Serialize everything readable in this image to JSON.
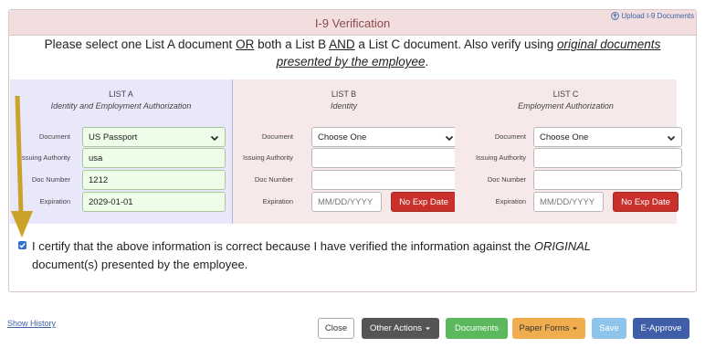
{
  "panel": {
    "title": "I-9 Verification",
    "upload_link": "Upload I-9 Documents"
  },
  "instructions": {
    "part1": "Please select one List A document ",
    "or": "OR",
    "part2": " both a List B ",
    "and": "AND",
    "part3": " a List C document. Also verify using ",
    "emph": "original documents presented by the employee",
    "end": "."
  },
  "list_a": {
    "title": "LIST A",
    "subtitle": "Identity and Employment Authorization",
    "document_label": "Document",
    "document_value": "US Passport",
    "issuing_label": "Issuing Authority",
    "issuing_value": "usa",
    "docnum_label": "Doc Number",
    "docnum_value": "1212",
    "expiration_label": "Expiration",
    "expiration_value": "2029-01-01"
  },
  "list_b": {
    "title": "LIST B",
    "subtitle": "Identity",
    "document_label": "Document",
    "document_value": "Choose One",
    "issuing_label": "Issuing Authority",
    "docnum_label": "Doc Number",
    "expiration_label": "Expiration",
    "expiration_placeholder": "MM/DD/YYYY",
    "no_exp_label": "No Exp Date"
  },
  "list_c": {
    "title": "LIST C",
    "subtitle": "Employment Authorization",
    "document_label": "Document",
    "document_value": "Choose One",
    "issuing_label": "Issuing Authority",
    "docnum_label": "Doc Number",
    "expiration_label": "Expiration",
    "expiration_placeholder": "MM/DD/YYYY",
    "no_exp_label": "No Exp Date"
  },
  "certify": {
    "checked": true,
    "text1": "I certify that the above information is correct because I have verified the information against the ",
    "emph": "ORIGINAL",
    "text2": " document(s) presented by the employee."
  },
  "footer": {
    "show_history": "Show History",
    "close": "Close",
    "other_actions": "Other Actions",
    "documents": "Documents",
    "paper_forms": "Paper Forms",
    "save": "Save",
    "e_approve": "E-Approve"
  },
  "colors": {
    "header_bg": "#f2dede",
    "list_a_bg": "#e9e8fb",
    "list_bc_bg": "#f7e9e9",
    "filled_field": "#eefde8",
    "danger": "#c9302c",
    "arrow": "#c9a227"
  }
}
